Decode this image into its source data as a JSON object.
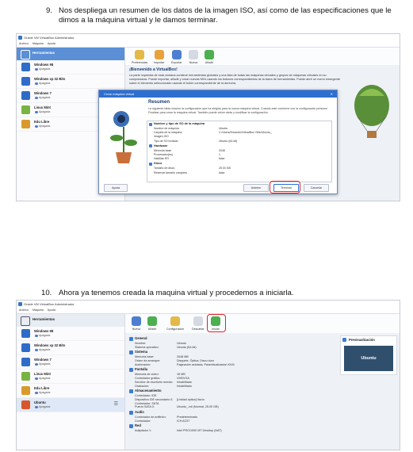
{
  "steps": [
    {
      "number": "9.",
      "text": "Nos despliega un resumen de los datos de la imagen ISO, así como de las especificaciones que le dimos a la máquina virtual y le damos terminar."
    },
    {
      "number": "10.",
      "text": "Ahora ya tenemos creada la maquina virtual y procedemos a iniciarla."
    }
  ],
  "screenshot1": {
    "window_title": "Oracle VM VirtualBox Administrador",
    "menu": [
      "Archivo",
      "Máquina",
      "Ayuda"
    ],
    "tools_label": "Herramientas",
    "vms": [
      {
        "name": "Windows 98",
        "state": "Apagada",
        "color": "#2f6cc8"
      },
      {
        "name": "Windows xp 32 Bits",
        "state": "Apagada",
        "color": "#2f6cc8"
      },
      {
        "name": "Windows 7",
        "state": "Apagada",
        "color": "#2f6cc8"
      },
      {
        "name": "Linux Mint",
        "state": "Apagada",
        "color": "#79b442"
      },
      {
        "name": "Edu Libre",
        "state": "Apagada",
        "color": "#d99a2b"
      }
    ],
    "toolbar": [
      "Preferencias",
      "Importar",
      "Exportar",
      "Nueva",
      "Añadir"
    ],
    "welcome_title": "¡Bienvenido a VirtualBox!",
    "welcome_text": "La parte izquierda de esta ventana contiene herramientas globales y una lista de todas las máquinas virtuales y grupos de máquinas virtuales en su computadora. Puede importar, añadir y crear nuevas MVs usando los botones correspondientes de la barra de herramientas. Puede abrir un menú emergente sobre el elemento seleccionado usando el botón correspondiente de la derecha.",
    "dialog": {
      "title": "Crear máquina virtual",
      "heading": "Resumen",
      "description": "La siguiente tabla resume la configuración que ha elegido para la nueva máquina virtual. Cuando esté conforme con la configuración presione Finalizar para crear la máquina virtual. También puede volver atrás y modificar la configuración.",
      "sections": [
        {
          "title": "Nombre y tipo de SO de la máquina",
          "rows": [
            {
              "k": "Nombre de máquina",
              "v": "Ubuntu"
            },
            {
              "k": "Carpeta de la máquina",
              "v": "C:/Users/Eduardo/VirtualBox VMs/Ubuntu_"
            },
            {
              "k": "Imagen ISO",
              "v": ""
            },
            {
              "k": "Tipo de SO invitado",
              "v": "Ubuntu (64-bit)"
            }
          ]
        },
        {
          "title": "Hardware",
          "rows": [
            {
              "k": "Memoria base",
              "v": "2048"
            },
            {
              "k": "Procesador(es)",
              "v": "1"
            },
            {
              "k": "Habilitar EFI",
              "v": "false"
            }
          ]
        },
        {
          "title": "Disco",
          "rows": [
            {
              "k": "Tamaño de disco",
              "v": "25.00 GB"
            },
            {
              "k": "Reservar tamaño completo",
              "v": "false"
            }
          ]
        }
      ],
      "help_button": "Ayuda",
      "back_button": "Anterior",
      "finish_button": "Terminar",
      "cancel_button": "Cancelar"
    }
  },
  "screenshot2": {
    "window_title": "Oracle VM VirtualBox Administrador",
    "menu": [
      "Archivo",
      "Máquina",
      "Ayuda"
    ],
    "tools_label": "Herramientas",
    "vms": [
      {
        "name": "Windows 98",
        "state": "Apagada",
        "color": "#2f6cc8"
      },
      {
        "name": "Windows xp 32 Bits",
        "state": "Apagada",
        "color": "#2f6cc8"
      },
      {
        "name": "Windows 7",
        "state": "Apagada",
        "color": "#2f6cc8"
      },
      {
        "name": "Linux Mint",
        "state": "Apagada",
        "color": "#79b442"
      },
      {
        "name": "Edu Libre",
        "state": "Apagada",
        "color": "#d99a2b"
      },
      {
        "name": "Ubuntu",
        "state": "Apagada",
        "color": "#d9562b"
      }
    ],
    "toolbar": [
      "Nueva",
      "Añadir",
      "Configuración",
      "Descartar",
      "Iniciar"
    ],
    "sections": [
      {
        "title": "General",
        "rows": [
          {
            "k": "Nombre:",
            "v": "Ubuntu"
          },
          {
            "k": "Sistema operativo:",
            "v": "Ubuntu (64-bit)"
          }
        ]
      },
      {
        "title": "Sistema",
        "rows": [
          {
            "k": "Memoria base:",
            "v": "2048 MB"
          },
          {
            "k": "Orden de arranque:",
            "v": "Disquete, Óptica, Disco duro"
          },
          {
            "k": "Aceleración:",
            "v": "Paginación anidada, Paravirtualización KVM"
          }
        ]
      },
      {
        "title": "Pantalla",
        "rows": [
          {
            "k": "Memoria de vídeo:",
            "v": "16 MB"
          },
          {
            "k": "Controlador gráfico:",
            "v": "VMSVGA"
          },
          {
            "k": "Servidor de escritorio remoto:",
            "v": "Inhabilitado"
          },
          {
            "k": "Grabación:",
            "v": "Inhabilitado"
          }
        ]
      },
      {
        "title": "Almacenamiento",
        "rows": [
          {
            "k": "Controlador: IDE",
            "v": ""
          },
          {
            "k": "Dispositivo IDE secundario 0:",
            "v": "[Unidad óptica] Vacío"
          },
          {
            "k": "Controlador: SATA",
            "v": ""
          },
          {
            "k": "Puerto SATA 0:",
            "v": "Ubuntu_.vdi (Normal, 25.00 GB)"
          }
        ]
      },
      {
        "title": "Audio",
        "rows": [
          {
            "k": "Controlador de anfitrión:",
            "v": "Predeterminado"
          },
          {
            "k": "Controlador:",
            "v": "ICH AC97"
          }
        ]
      },
      {
        "title": "Red",
        "rows": [
          {
            "k": "Adaptador 1:",
            "v": "Intel PRO/1000 MT Desktop (NAT)"
          }
        ]
      }
    ],
    "preview_label": "Previsualización",
    "preview_screen": "Ubuntu"
  }
}
